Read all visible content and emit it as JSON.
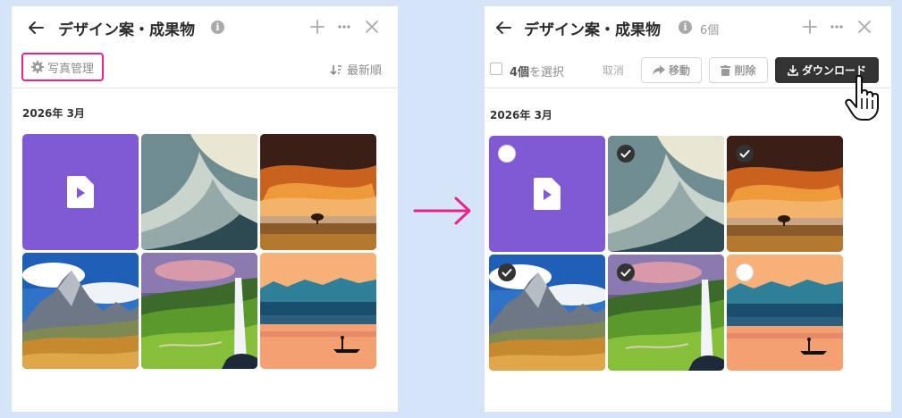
{
  "before": {
    "title": "デザイン案・成果物",
    "manage_label": "写真管理",
    "sort_label": "最新順",
    "date_label": "2026年 3月"
  },
  "after": {
    "title": "デザイン案・成果物",
    "count_label": "6個",
    "select_count": "4個",
    "select_suffix": "を選択",
    "cancel_label": "取消",
    "move_label": "移動",
    "delete_label": "削除",
    "download_label": "ダウンロード",
    "date_label": "2026年 3月",
    "tiles": [
      {
        "type": "video",
        "selected": false
      },
      {
        "type": "abstract-curve",
        "selected": true
      },
      {
        "type": "sunset-tree",
        "selected": true
      },
      {
        "type": "mountains",
        "selected": true
      },
      {
        "type": "waterfall",
        "selected": true
      },
      {
        "type": "lake-boat",
        "selected": false
      }
    ]
  },
  "colors": {
    "accent_pink": "#e8238b",
    "video_tile": "#805ad5",
    "download_bg": "#333333",
    "page_bg": "#d5e4f7"
  }
}
